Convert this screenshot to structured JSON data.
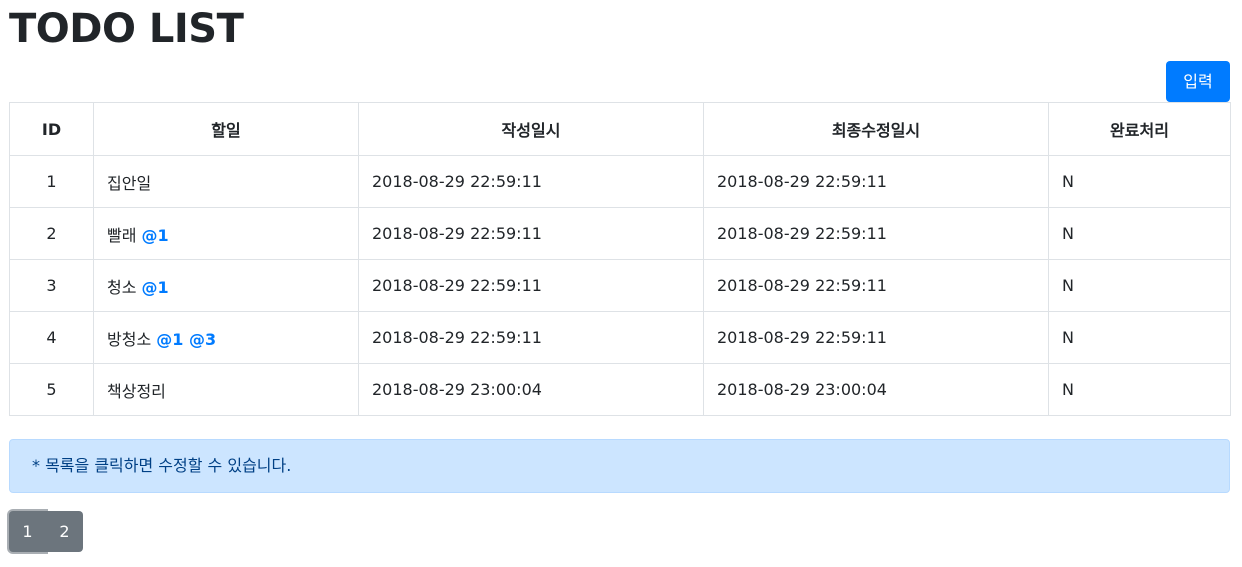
{
  "title": "TODO LIST",
  "toolbar": {
    "add_label": "입력"
  },
  "table": {
    "headers": [
      "ID",
      "할일",
      "작성일시",
      "최종수정일시",
      "완료처리"
    ],
    "rows": [
      {
        "id": "1",
        "task": "집안일",
        "refs": "",
        "created": "2018-08-29 22:59:11",
        "modified": "2018-08-29 22:59:11",
        "done": "N"
      },
      {
        "id": "2",
        "task": "빨래",
        "refs": "@1",
        "created": "2018-08-29 22:59:11",
        "modified": "2018-08-29 22:59:11",
        "done": "N"
      },
      {
        "id": "3",
        "task": "청소",
        "refs": "@1",
        "created": "2018-08-29 22:59:11",
        "modified": "2018-08-29 22:59:11",
        "done": "N"
      },
      {
        "id": "4",
        "task": "방청소",
        "refs": "@1 @3",
        "created": "2018-08-29 22:59:11",
        "modified": "2018-08-29 22:59:11",
        "done": "N"
      },
      {
        "id": "5",
        "task": "책상정리",
        "refs": "",
        "created": "2018-08-29 23:00:04",
        "modified": "2018-08-29 23:00:04",
        "done": "N"
      }
    ]
  },
  "notice": "* 목록을 클릭하면 수정할 수 있습니다.",
  "pagination": {
    "pages": [
      "1",
      "2"
    ],
    "current": "1"
  },
  "colors": {
    "primary": "#007bff",
    "info_bg": "#cce5ff",
    "info_text": "#004085",
    "pager": "#6c757d"
  }
}
